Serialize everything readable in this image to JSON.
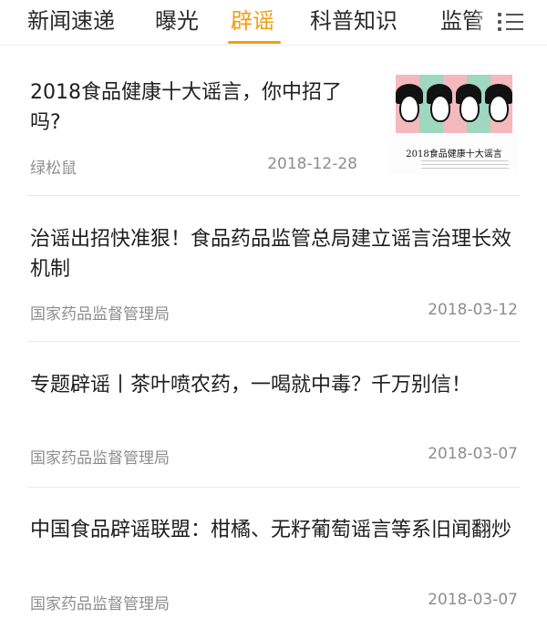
{
  "tabs": [
    {
      "label": "新闻速递",
      "active": false
    },
    {
      "label": "曝光",
      "active": false
    },
    {
      "label": "辟谣",
      "active": true
    },
    {
      "label": "科普知识",
      "active": false
    },
    {
      "label": "监管",
      "active": false
    }
  ],
  "menu_icon": "list-menu-icon",
  "accent_color": "#f39c12",
  "articles": [
    {
      "title": "2018食品健康十大谣言，你中招了吗?",
      "source": "绿松鼠",
      "date": "2018-12-28",
      "thumbnail_caption": "2018食品健康十大谣言"
    },
    {
      "title": "治谣出招快准狠！食品药品监管总局建立谣言治理长效机制",
      "source": "国家药品监督管理局",
      "date": "2018-03-12"
    },
    {
      "title": "专题辟谣丨茶叶喷农药，一喝就中毒？千万别信！",
      "source": "国家药品监督管理局",
      "date": "2018-03-07"
    },
    {
      "title": "中国食品辟谣联盟：柑橘、无籽葡萄谣言等系旧闻翻炒",
      "source": "国家药品监督管理局",
      "date": "2018-03-07"
    }
  ]
}
